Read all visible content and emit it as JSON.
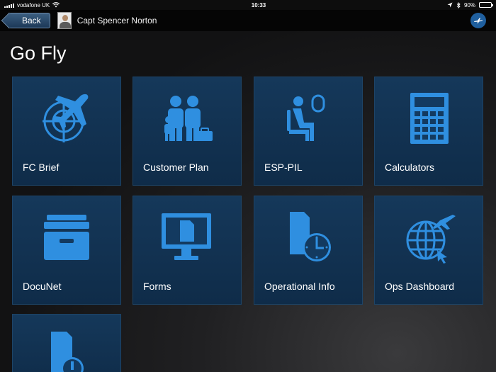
{
  "status_bar": {
    "carrier": "vodafone UK",
    "time": "10:33",
    "battery": "90%",
    "battery_level": 0.9
  },
  "nav": {
    "back_label": "Back",
    "user_name": "Capt Spencer Norton"
  },
  "page": {
    "title": "Go Fly"
  },
  "colors": {
    "tile": "#143558",
    "icon": "#2f8fe0",
    "nav": "#050505"
  },
  "tiles": [
    {
      "label": "FC Brief",
      "icon": "plane-target-icon"
    },
    {
      "label": "Customer Plan",
      "icon": "family-icon"
    },
    {
      "label": "ESP-PIL",
      "icon": "seated-passenger-icon"
    },
    {
      "label": "Calculators",
      "icon": "calculator-icon"
    },
    {
      "label": "DocuNet",
      "icon": "file-drawer-icon"
    },
    {
      "label": "Forms",
      "icon": "monitor-document-icon"
    },
    {
      "label": "Operational Info",
      "icon": "document-clock-icon"
    },
    {
      "label": "Ops Dashboard",
      "icon": "globe-plane-icon"
    },
    {
      "label": "",
      "icon": "document-alert-icon"
    }
  ]
}
